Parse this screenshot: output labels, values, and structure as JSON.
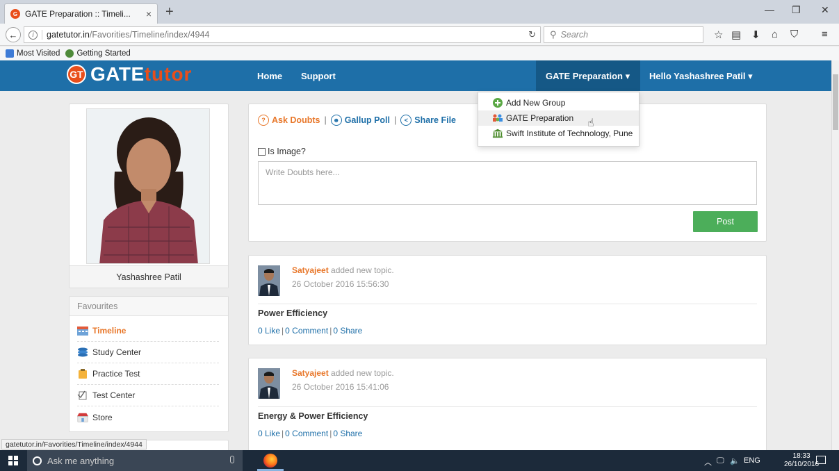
{
  "browser": {
    "tab_title": "GATE Preparation :: Timeli...",
    "tab_close": "×",
    "new_tab": "+",
    "url_domain": "gatetutor.in",
    "url_path": "/Favorities/Timeline/index/4944",
    "search_placeholder": "Search",
    "bookmarks": [
      "Most Visited",
      "Getting Started"
    ],
    "status_url": "gatetutor.in/Favorities/Timeline/index/4944"
  },
  "site": {
    "logo_badge": "GT",
    "logo_gate": "GATE",
    "logo_tutor": "tutor",
    "nav": [
      "Home",
      "Support"
    ],
    "group_menu": "GATE Preparation ▾",
    "user_menu": "Hello Yashashree Patil ▾",
    "dropdown": [
      "Add New Group",
      "GATE Preparation",
      "Swift Institute of Technology, Pune"
    ]
  },
  "profile": {
    "name": "Yashashree Patil"
  },
  "favourites": {
    "heading": "Favourites",
    "items": [
      "Timeline",
      "Study Center",
      "Practice Test",
      "Test Center",
      "Store"
    ]
  },
  "composer": {
    "ask": "Ask Doubts",
    "poll": "Gallup Poll",
    "share": "Share File",
    "sep": "|",
    "is_image": "Is Image?",
    "placeholder": "Write Doubts here...",
    "post": "Post"
  },
  "feed": [
    {
      "author": "Satyajeet",
      "action": " added new topic.",
      "date": "26 October 2016 15:56:30",
      "title": "Power Efficiency",
      "like": "0 Like",
      "comment": "0 Comment",
      "share": "0 Share"
    },
    {
      "author": "Satyajeet",
      "action": " added new topic.",
      "date": "26 October 2016 15:41:06",
      "title": "Energy & Power Efficiency",
      "like": "0 Like",
      "comment": "0 Comment",
      "share": "0 Share"
    }
  ],
  "taskbar": {
    "search": "Ask me anything",
    "lang": "ENG",
    "time": "18:33",
    "date": "26/10/2016"
  },
  "colors": {
    "header": "#1e6fa8",
    "accent": "#e8772a",
    "post_button": "#4cae5a"
  }
}
